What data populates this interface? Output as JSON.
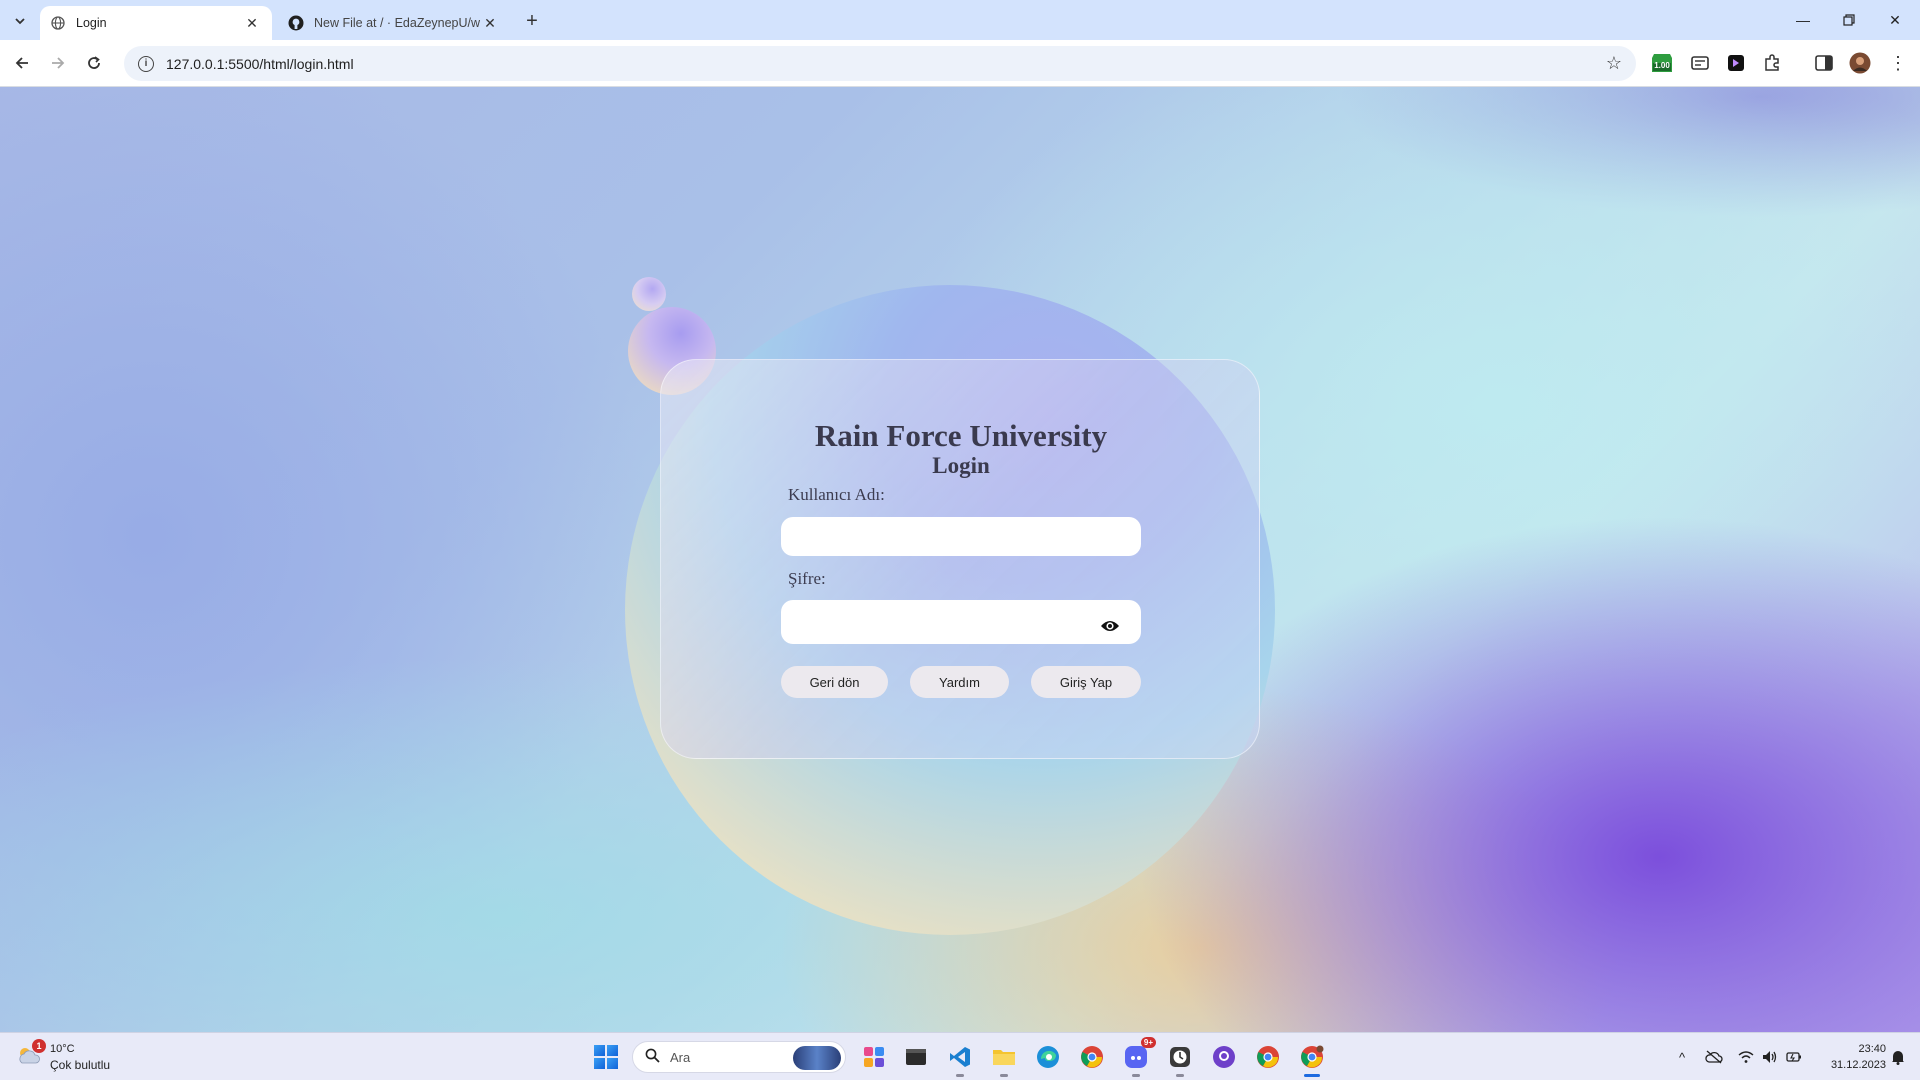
{
  "browser": {
    "tabs": [
      {
        "title": "Login",
        "active": true
      },
      {
        "title": "New File at / · EdaZeynepU/wel",
        "active": false
      }
    ],
    "url": "127.0.0.1:5500/html/login.html",
    "extension_badge": "1.00"
  },
  "page": {
    "university": "Rain Force University",
    "heading": "Login",
    "username_label": "Kullanıcı Adı:",
    "username_value": "",
    "password_label": "Şifre:",
    "password_value": "",
    "buttons": {
      "back": "Geri dön",
      "help": "Yardım",
      "login": "Giriş Yap"
    }
  },
  "taskbar": {
    "weather_temp": "10°C",
    "weather_desc": "Çok bulutlu",
    "weather_badge": "1",
    "search_placeholder": "Ara",
    "discord_badge": "9+",
    "time": "23:40",
    "date": "31.12.2023"
  }
}
